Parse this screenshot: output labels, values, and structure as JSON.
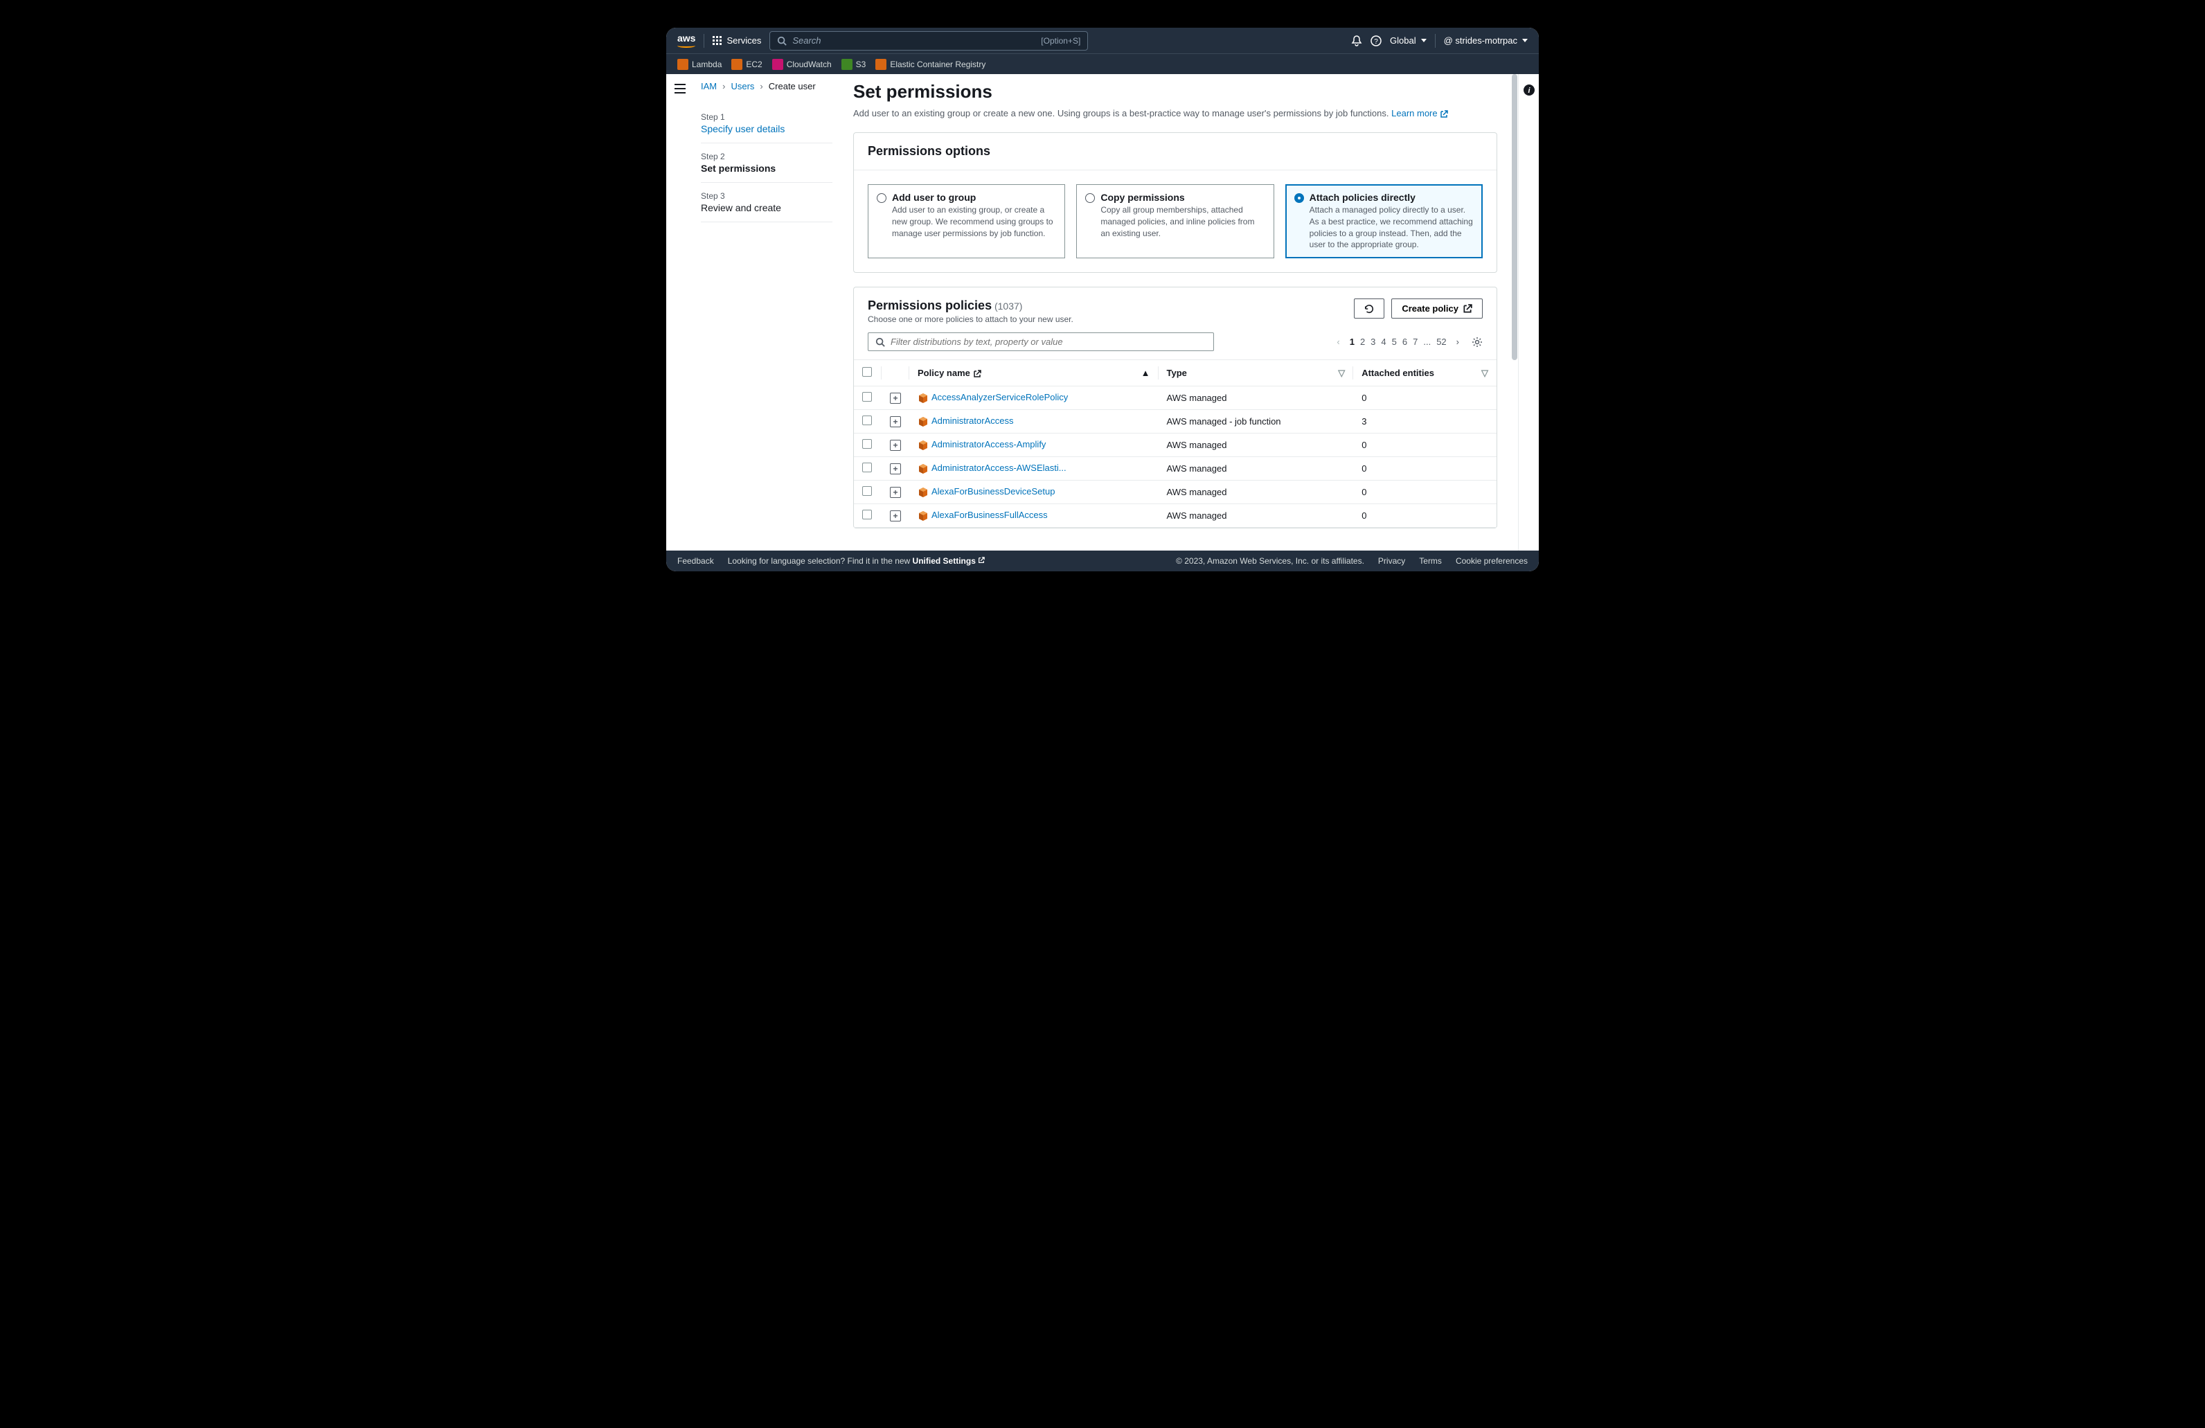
{
  "topbar": {
    "services": "Services",
    "search_placeholder": "Search",
    "search_hint": "[Option+S]",
    "region": "Global",
    "account": "@ strides-motrpac"
  },
  "servicebar": [
    {
      "name": "Lambda",
      "color": "#d86613"
    },
    {
      "name": "EC2",
      "color": "#d86613"
    },
    {
      "name": "CloudWatch",
      "color": "#c7136f"
    },
    {
      "name": "S3",
      "color": "#3f8624"
    },
    {
      "name": "Elastic Container Registry",
      "color": "#d86613"
    }
  ],
  "breadcrumb": {
    "iam": "IAM",
    "users": "Users",
    "create": "Create user"
  },
  "steps": [
    {
      "num": "Step 1",
      "title": "Specify user details",
      "state": "link"
    },
    {
      "num": "Step 2",
      "title": "Set permissions",
      "state": "active"
    },
    {
      "num": "Step 3",
      "title": "Review and create",
      "state": "normal"
    }
  ],
  "page": {
    "title": "Set permissions",
    "desc": "Add user to an existing group or create a new one. Using groups is a best-practice way to manage user's permissions by job functions. ",
    "learn_more": "Learn more"
  },
  "perm_options": {
    "header": "Permissions options",
    "opts": [
      {
        "title": "Add user to group",
        "desc": "Add user to an existing group, or create a new group. We recommend using groups to manage user permissions by job function."
      },
      {
        "title": "Copy permissions",
        "desc": "Copy all group memberships, attached managed policies, and inline policies from an existing user."
      },
      {
        "title": "Attach policies directly",
        "desc": "Attach a managed policy directly to a user. As a best practice, we recommend attaching policies to a group instead. Then, add the user to the appropriate group."
      }
    ],
    "selected": 2
  },
  "policies": {
    "title": "Permissions policies",
    "count": "(1037)",
    "sub": "Choose one or more policies to attach to your new user.",
    "create_btn": "Create policy",
    "filter_placeholder": "Filter distributions by text, property or value",
    "pages": [
      "1",
      "2",
      "3",
      "4",
      "5",
      "6",
      "7",
      "...",
      "52"
    ],
    "current_page": "1",
    "columns": {
      "name": "Policy name",
      "type": "Type",
      "entities": "Attached entities"
    },
    "rows": [
      {
        "name": "AccessAnalyzerServiceRolePolicy",
        "type": "AWS managed",
        "entities": "0"
      },
      {
        "name": "AdministratorAccess",
        "type": "AWS managed - job function",
        "entities": "3"
      },
      {
        "name": "AdministratorAccess-Amplify",
        "type": "AWS managed",
        "entities": "0"
      },
      {
        "name": "AdministratorAccess-AWSElasti...",
        "type": "AWS managed",
        "entities": "0"
      },
      {
        "name": "AlexaForBusinessDeviceSetup",
        "type": "AWS managed",
        "entities": "0"
      },
      {
        "name": "AlexaForBusinessFullAccess",
        "type": "AWS managed",
        "entities": "0"
      }
    ]
  },
  "footer": {
    "feedback": "Feedback",
    "lang_prefix": "Looking for language selection? Find it in the new ",
    "lang_link": "Unified Settings",
    "copyright": "© 2023, Amazon Web Services, Inc. or its affiliates.",
    "privacy": "Privacy",
    "terms": "Terms",
    "cookies": "Cookie preferences"
  }
}
